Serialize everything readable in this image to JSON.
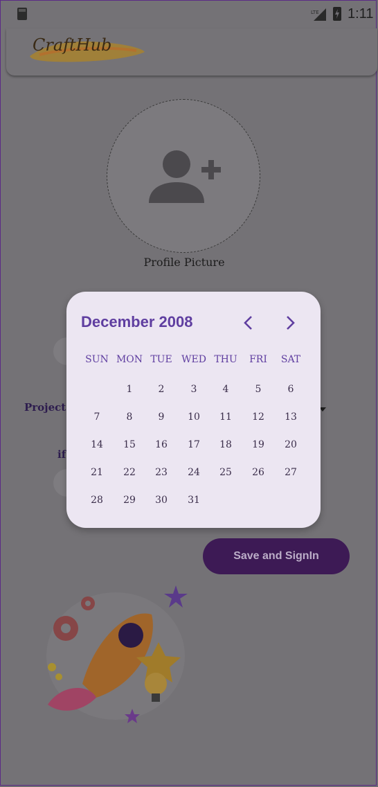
{
  "status_bar": {
    "time": "1:11",
    "network": "LTE"
  },
  "app": {
    "logo_text": "CraftHub"
  },
  "profile": {
    "label": "Profile Picture"
  },
  "form": {
    "project_label": "Project",
    "if_label": "if",
    "save_button": "Save and SignIn"
  },
  "calendar": {
    "month_year": "December 2008",
    "weekdays": [
      "SUN",
      "MON",
      "TUE",
      "WED",
      "THU",
      "FRI",
      "SAT"
    ],
    "days": [
      "1",
      "2",
      "3",
      "4",
      "5",
      "6",
      "7",
      "8",
      "9",
      "10",
      "11",
      "12",
      "13",
      "14",
      "15",
      "16",
      "17",
      "18",
      "19",
      "20",
      "21",
      "22",
      "23",
      "24",
      "25",
      "26",
      "27",
      "28",
      "29",
      "30",
      "31"
    ]
  },
  "colors": {
    "accent": "#5f3ea0",
    "dialog_bg": "#ece6f2",
    "button_bg": "#3d1a55",
    "scrim": "#747276"
  }
}
